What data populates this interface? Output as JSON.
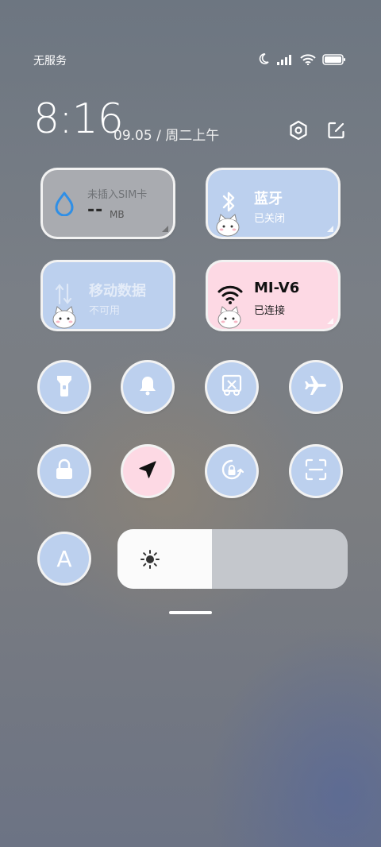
{
  "status_bar": {
    "carrier": "无服务",
    "icons": [
      "moon-icon",
      "signal-icon",
      "wifi-icon",
      "battery-icon"
    ]
  },
  "header": {
    "time": "8:16",
    "date": "09.05 / 周二上午",
    "icons": [
      "settings-icon",
      "edit-icon"
    ]
  },
  "tiles": {
    "data_usage": {
      "title": "未插入SIM卡",
      "value": "--",
      "unit": "MB",
      "icon": "water-drop-icon"
    },
    "bluetooth": {
      "title": "蓝牙",
      "status": "已关闭",
      "icon": "bluetooth-icon"
    },
    "mobile_data": {
      "title": "移动数据",
      "status": "不可用",
      "icon": "data-arrows-icon"
    },
    "wifi": {
      "title": "MI-V6",
      "status": "已连接",
      "icon": "wifi-icon"
    }
  },
  "toggles_row1": [
    "flashlight-icon",
    "bell-icon",
    "screenshot-icon",
    "airplane-icon"
  ],
  "toggles_row2": [
    "lock-icon",
    "location-icon",
    "rotation-lock-icon",
    "scan-icon"
  ],
  "auto_brightness": {
    "label": "A"
  },
  "brightness": {
    "level": 0.41,
    "icon": "sun-icon"
  },
  "colors": {
    "blue": "#bcd0ee",
    "pink": "#fdd9e4",
    "grey_tile": "#a9abb0",
    "accent": "#2f8fe6"
  }
}
